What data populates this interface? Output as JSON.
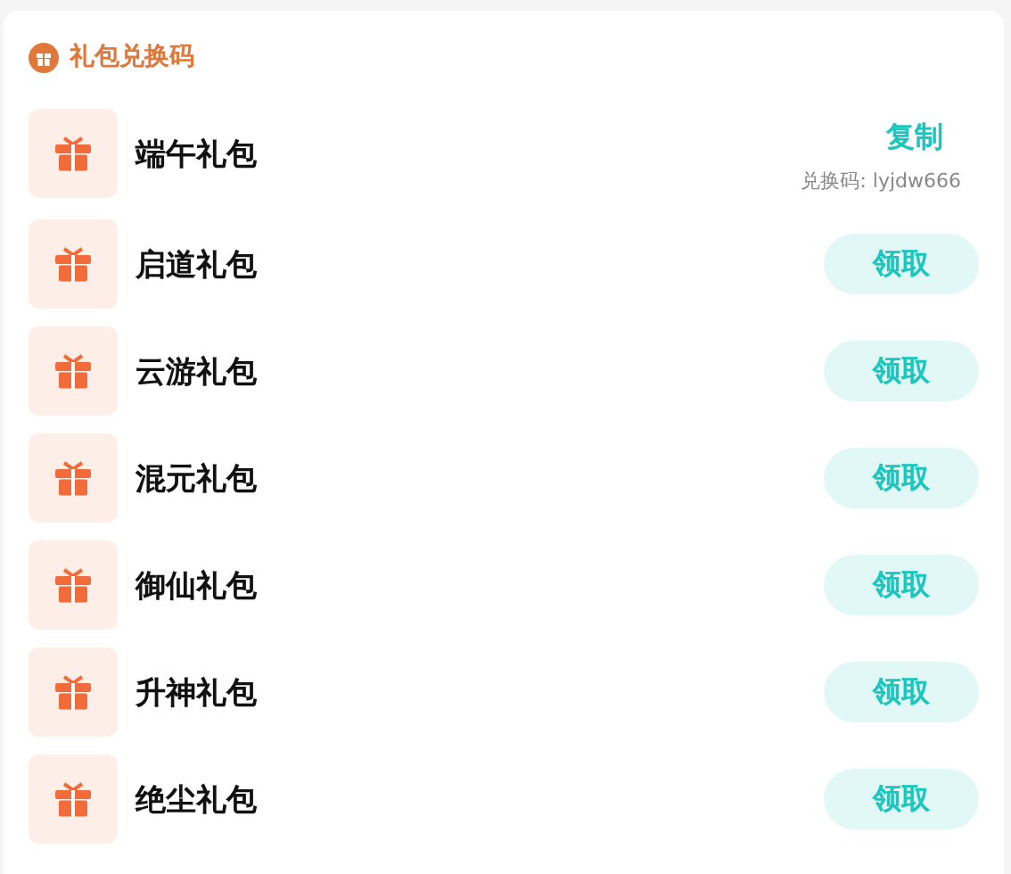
{
  "header": {
    "title": "礼包兑换码"
  },
  "gifts": [
    {
      "name": "端午礼包",
      "kind": "copy",
      "action": "复制",
      "code": "兑换码: lyjdw666"
    },
    {
      "name": "启道礼包",
      "kind": "claim",
      "action": "领取"
    },
    {
      "name": "云游礼包",
      "kind": "claim",
      "action": "领取"
    },
    {
      "name": "混元礼包",
      "kind": "claim",
      "action": "领取"
    },
    {
      "name": "御仙礼包",
      "kind": "claim",
      "action": "领取"
    },
    {
      "name": "升神礼包",
      "kind": "claim",
      "action": "领取"
    },
    {
      "name": "绝尘礼包",
      "kind": "claim",
      "action": "领取"
    }
  ]
}
